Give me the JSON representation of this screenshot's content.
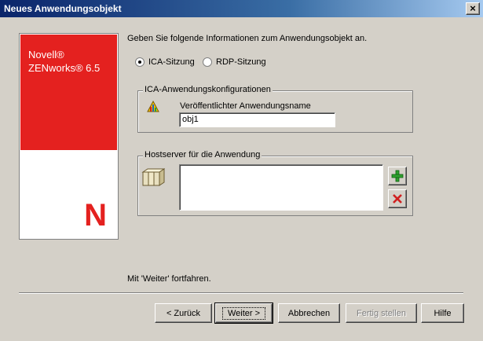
{
  "window": {
    "title": "Neues Anwendungsobjekt",
    "close_glyph": "×"
  },
  "branding": {
    "company": "Novell®",
    "product": "ZENworks® 6.5",
    "logo_letter": "N"
  },
  "instruction": "Geben Sie folgende Informationen zum Anwendungsobjekt an.",
  "session_type": {
    "options": [
      {
        "label": "ICA-Sitzung",
        "selected": true
      },
      {
        "label": "RDP-Sitzung",
        "selected": false
      }
    ]
  },
  "ica_group": {
    "legend": "ICA-Anwendungskonfigurationen",
    "icon": "citrix-app-icon",
    "field_label": "Veröffentlichter Anwendungsname",
    "field_value": "obj1"
  },
  "host_group": {
    "legend": "Hostserver für die Anwendung",
    "icon": "server-icon",
    "items": [],
    "add_icon": "add-icon",
    "remove_icon": "remove-icon"
  },
  "continue_hint": "Mit 'Weiter' fortfahren.",
  "buttons": {
    "back": "< Zurück",
    "next": "Weiter >",
    "cancel": "Abbrechen",
    "finish": "Fertig stellen",
    "help": "Hilfe"
  },
  "colors": {
    "brand_red": "#e4211f",
    "title_bar": "#0a246a",
    "dialog_bg": "#d4d0c8"
  }
}
